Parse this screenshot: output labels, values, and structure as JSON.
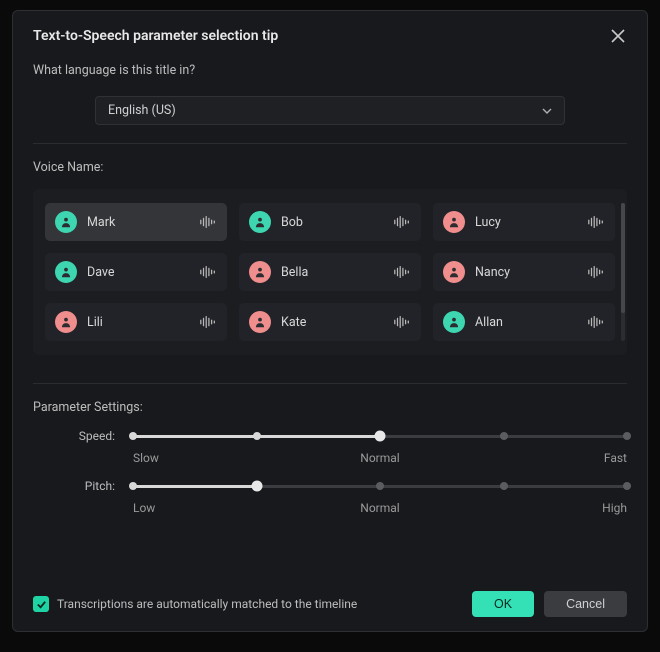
{
  "dialog": {
    "title": "Text-to-Speech parameter selection tip",
    "language_question": "What language is this title in?",
    "language_selected": "English (US)"
  },
  "voice": {
    "label": "Voice Name:",
    "selected_index": 0,
    "items": [
      {
        "name": "Mark",
        "avatar": "teal"
      },
      {
        "name": "Bob",
        "avatar": "teal"
      },
      {
        "name": "Lucy",
        "avatar": "pink"
      },
      {
        "name": "Dave",
        "avatar": "teal"
      },
      {
        "name": "Bella",
        "avatar": "pink"
      },
      {
        "name": "Nancy",
        "avatar": "pink"
      },
      {
        "name": "Lili",
        "avatar": "pink"
      },
      {
        "name": "Kate",
        "avatar": "pink"
      },
      {
        "name": "Allan",
        "avatar": "teal"
      }
    ]
  },
  "params": {
    "label": "Parameter Settings:",
    "speed": {
      "name": "Speed:",
      "value_pct": 50,
      "labels": {
        "low": "Slow",
        "mid": "Normal",
        "high": "Fast"
      }
    },
    "pitch": {
      "name": "Pitch:",
      "value_pct": 25,
      "labels": {
        "low": "Low",
        "mid": "Normal",
        "high": "High"
      }
    }
  },
  "footer": {
    "checkbox_checked": true,
    "checkbox_label": "Transcriptions are automatically matched to the timeline",
    "ok": "OK",
    "cancel": "Cancel"
  }
}
